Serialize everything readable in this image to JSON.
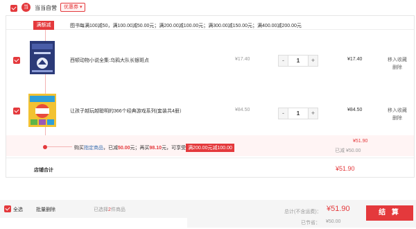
{
  "shop": {
    "logo_text": "当",
    "name": "当当自营",
    "coupon_label": "优惠券"
  },
  "promo": {
    "tag": "满额减",
    "rule_text": "图书每满100减50，满100.00减50.00元；满200.00减100.00元；满300.00减150.00元；满400.00减200.00元"
  },
  "items": [
    {
      "title": "西顿动物小说全集:乌鸦大队长银斑点",
      "unit_price": "¥17.40",
      "qty": "1",
      "subtotal": "¥17.40",
      "action_fav": "移入收藏",
      "action_delete": "删除"
    },
    {
      "title": "让孩子越玩越聪明的366个经典游戏系列(套装共4册）",
      "unit_price": "¥84.50",
      "qty": "1",
      "subtotal": "¥84.50",
      "action_fav": "移入收藏",
      "action_delete": "删除"
    }
  ],
  "qty_controls": {
    "minus": "-",
    "plus": "+"
  },
  "promo_summary": {
    "prefix": "购买",
    "link": "指定商品",
    "reduced_label": "，已减",
    "reduced_value": "50.00",
    "rebuy_label": "元；再买",
    "rebuy_value": "98.10",
    "tail": "元，可享受",
    "badge": "满200.00元减100.00",
    "total": "¥51.90",
    "saved": "已减 ¥50.00"
  },
  "shop_total": {
    "label": "店铺合计",
    "value": "¥51.90"
  },
  "footer": {
    "select_all": "全选",
    "batch_delete": "批量删除",
    "selected_prefix": "已选择",
    "selected_count": "2",
    "selected_suffix": "件商品",
    "total_label": "总计(不含运费)：",
    "total_value": "¥51.90",
    "saved_label": "已节省：",
    "saved_value": "¥50.00",
    "checkout": "结 算"
  },
  "colors": {
    "accent": "#e4393c"
  }
}
